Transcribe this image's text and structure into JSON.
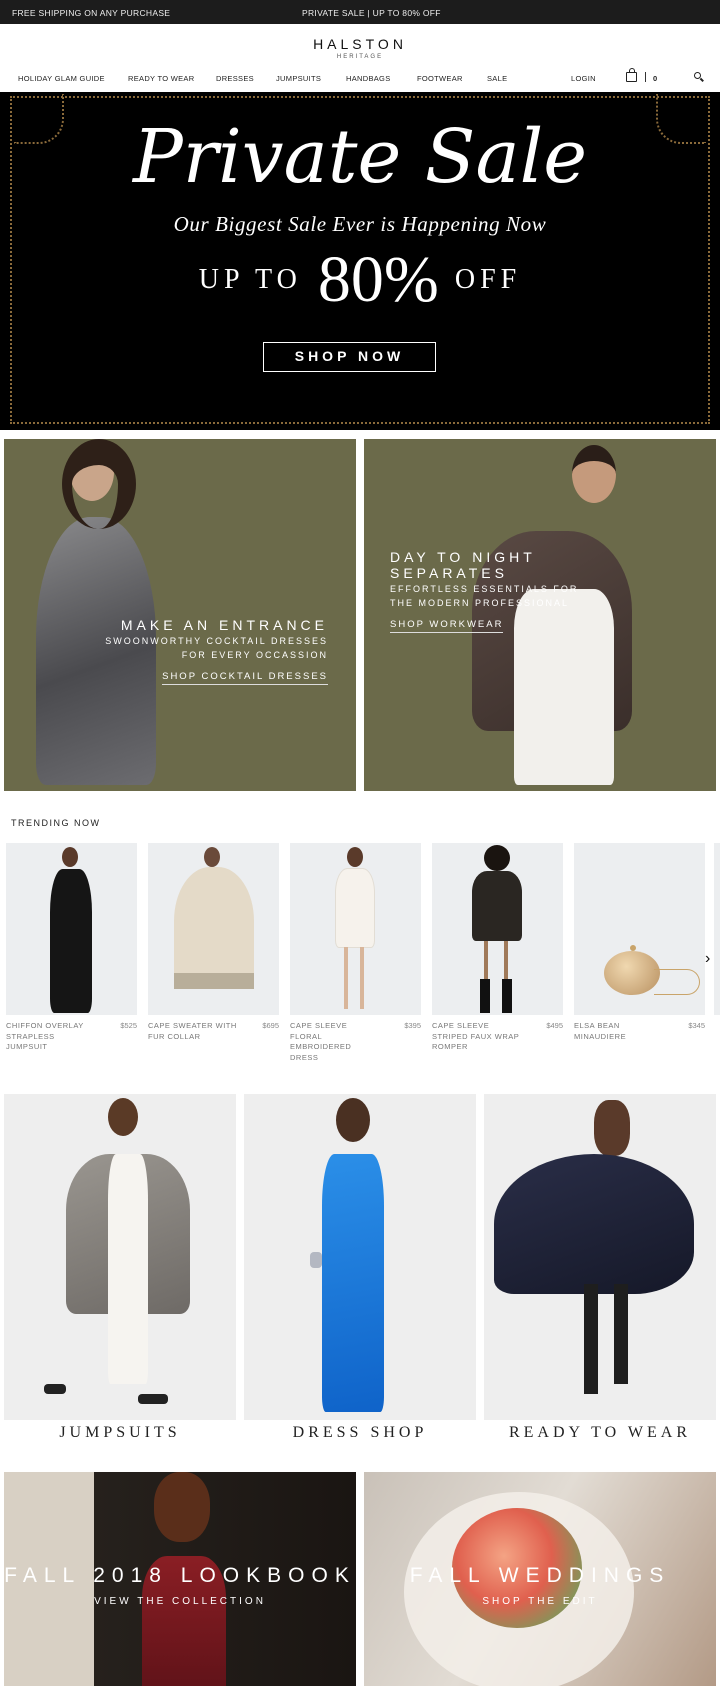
{
  "topbar": {
    "shipping": "FREE SHIPPING ON ANY PURCHASE",
    "promo": "PRIVATE SALE | UP TO 80% OFF"
  },
  "brand": {
    "name": "HALSTON",
    "sub": "HERITAGE"
  },
  "nav": {
    "items": [
      "HOLIDAY GLAM GUIDE",
      "READY TO WEAR",
      "DRESSES",
      "JUMPSUITS",
      "HANDBAGS",
      "FOOTWEAR",
      "SALE"
    ],
    "login": "LOGIN",
    "cart_count": "0"
  },
  "hero": {
    "title": "Private Sale",
    "subtitle": "Our Biggest Sale Ever is Happening Now",
    "up_to": "UP TO",
    "percent": "80%",
    "off": "OFF",
    "cta": "SHOP NOW"
  },
  "panels": [
    {
      "heading": "MAKE AN ENTRANCE",
      "line1": "SWOONWORTHY COCKTAIL DRESSES",
      "line2": "FOR EVERY OCCASSION",
      "link": "SHOP COCKTAIL DRESSES"
    },
    {
      "heading": "DAY TO NIGHT SEPARATES",
      "line1": "EFFORTLESS ESSENTIALS FOR",
      "line2": "THE MODERN PROFESSIONAL",
      "link": "SHOP WORKWEAR"
    }
  ],
  "trending": {
    "title": "TRENDING NOW",
    "products": [
      {
        "name": "CHIFFON OVERLAY STRAPLESS JUMPSUIT",
        "price": "$525"
      },
      {
        "name": "CAPE SWEATER WITH FUR COLLAR",
        "price": "$695"
      },
      {
        "name": "CAPE SLEEVE FLORAL EMBROIDERED DRESS",
        "price": "$395"
      },
      {
        "name": "CAPE SLEEVE STRIPED FAUX WRAP ROMPER",
        "price": "$495"
      },
      {
        "name": "ELSA BEAN MINAUDIERE",
        "price": "$345"
      }
    ]
  },
  "categories": [
    "JUMPSUITS",
    "DRESS SHOP",
    "READY TO WEAR"
  ],
  "features": [
    {
      "heading": "FALL 2018 LOOKBOOK",
      "link": "VIEW THE COLLECTION"
    },
    {
      "heading": "FALL WEDDINGS",
      "link": "SHOP THE EDIT"
    }
  ],
  "colors": {
    "topbar": "#1c1c1c",
    "panel_olive": "#6b6a4a",
    "gold_frame": "#8a6a3a"
  }
}
